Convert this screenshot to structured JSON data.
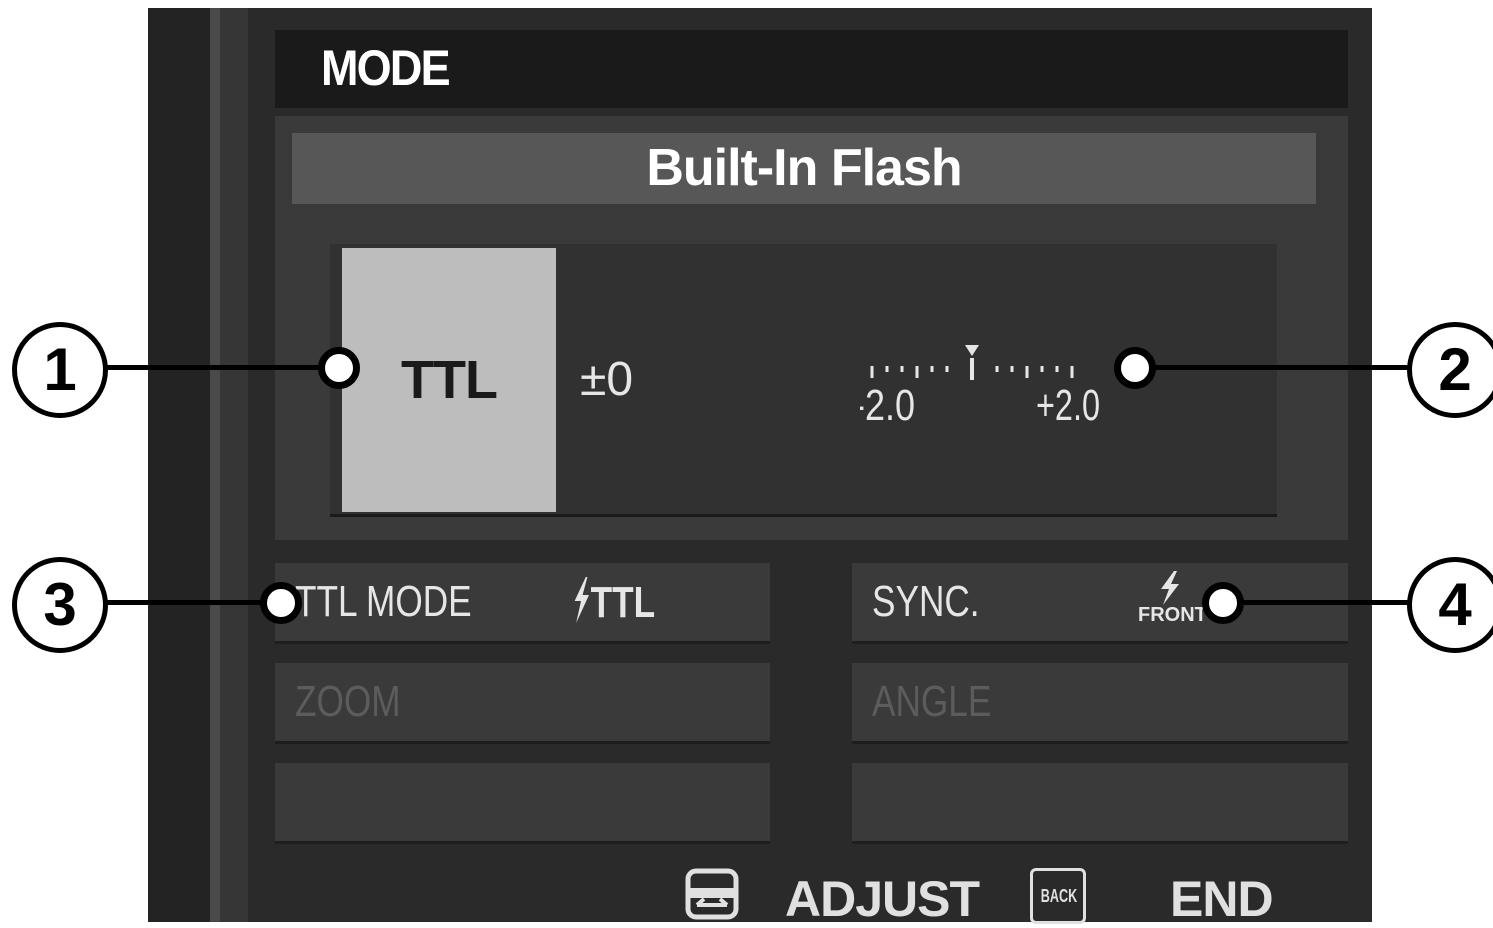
{
  "title": "MODE",
  "flash": {
    "heading": "Built-In Flash",
    "mode": "TTL",
    "compensation": "±0",
    "scale": {
      "min_label": "-2.0",
      "max_label": "+2.0"
    }
  },
  "options": [
    {
      "label": "TTL MODE",
      "value": "TTL",
      "enabled": true
    },
    {
      "label": "SYNC.",
      "value": "FRONT",
      "enabled": true
    },
    {
      "label": "ZOOM",
      "value": "",
      "enabled": false
    },
    {
      "label": "ANGLE",
      "value": "",
      "enabled": false
    }
  ],
  "footer": {
    "adjust": "ADJUST",
    "back_icon_text": "BACK",
    "end": "END"
  },
  "callouts": [
    "1",
    "2",
    "3",
    "4"
  ],
  "icons": {
    "ttl_mode": "flash-bolt-icon",
    "sync": "flash-bolt-icon",
    "adjust": "command-dial-icon",
    "back": "back-button-icon"
  }
}
